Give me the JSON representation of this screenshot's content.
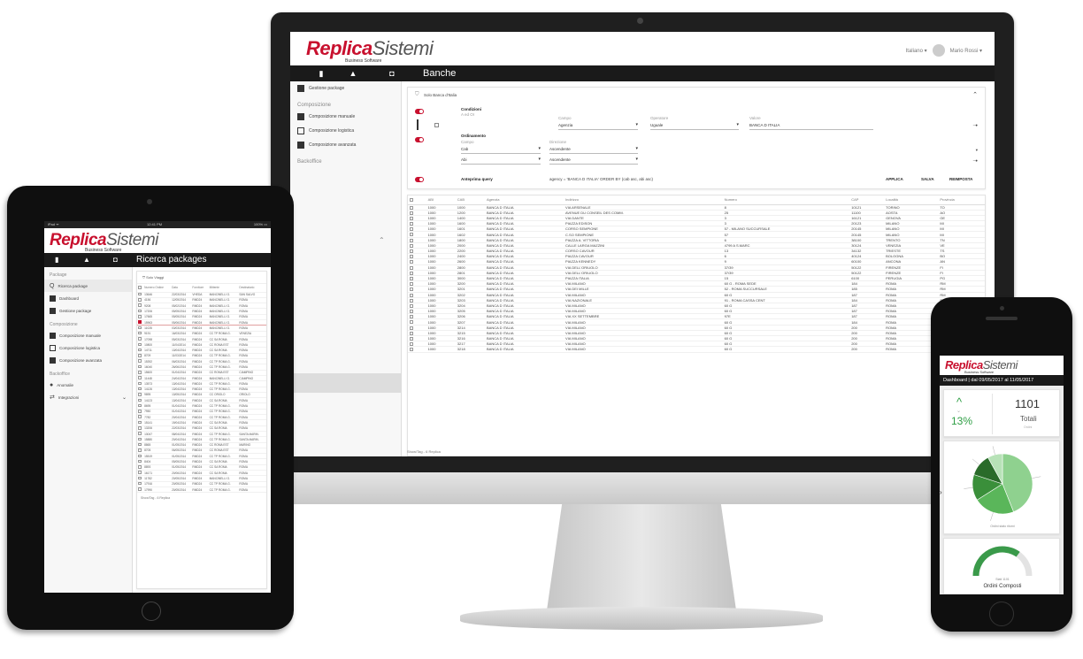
{
  "brand": {
    "name_a": "Replica",
    "name_b": "Sistemi",
    "tagline": "Business Software"
  },
  "desktop": {
    "user": {
      "language": "Italiano ▾",
      "name": "Mario Rossi ▾"
    },
    "nav_title": "Banche",
    "sidebar": {
      "top_item": "Gestione package",
      "section_composizione": "Composizione",
      "items": [
        "Composizione manuale",
        "Composizione logistica",
        "Composizione avanzata"
      ],
      "section_backoffice": "Backoffice"
    },
    "filter": {
      "title": "Solo Banca d'Italia",
      "conditions_label": "Condizioni",
      "conditions_sub": "A ed OI",
      "campo_label": "Campo",
      "campo_value": "Agenzia",
      "operatore_label": "Operatore",
      "operatore_value": "Uguale",
      "valore_label": "Valore",
      "valore_value": "BANCA D ITALIA",
      "ordering_label": "Ordinamento",
      "ord_campo_label": "Campo",
      "ord_dir_label": "Direzione",
      "ord_rows": [
        {
          "campo": "Cab",
          "dir": "Ascendente"
        },
        {
          "campo": "Abi",
          "dir": "Ascendente"
        }
      ],
      "query_label": "Anteprima query",
      "query_value": "agency = 'BANCA D ITALIA' ORDER BY (cab asc, abi asc)",
      "apply": "APPLICA",
      "save": "SALVA",
      "reset": "REIMPOSTA"
    },
    "table": {
      "headers": [
        "ABI",
        "CAB",
        "Agenzia",
        "Indirizzo",
        "Numero",
        "CAP",
        "Località",
        "Provincia"
      ],
      "rows": [
        [
          "1000",
          "1000",
          "BANCA D ITALIA",
          "VIA ARSENALE",
          "8",
          "10121",
          "TORINO",
          "TO"
        ],
        [
          "1000",
          "1200",
          "BANCA D ITALIA",
          "AVENUE DU CONSEIL DES COMM.",
          "25",
          "11100",
          "AOSTA",
          "AO"
        ],
        [
          "1000",
          "1400",
          "BANCA D ITALIA",
          "VIA DANTE",
          "3",
          "16121",
          "GENOVA",
          "GE"
        ],
        [
          "1000",
          "1600",
          "BANCA D ITALIA",
          "PIAZZA EDISON",
          "3",
          "20123",
          "MILANO",
          "MI"
        ],
        [
          "1000",
          "1601",
          "BANCA D ITALIA",
          "CORSO SEMPIONE",
          "57 - MILANO SUCCURSALE",
          "20145",
          "MILANO",
          "MI"
        ],
        [
          "1000",
          "1602",
          "BANCA D ITALIA",
          "C.SO SEMPIONE",
          "57",
          "20145",
          "MILANO",
          "MI"
        ],
        [
          "1000",
          "1800",
          "BANCA D ITALIA",
          "PIAZZA A. VITTORIA",
          "6",
          "38100",
          "TRENTO",
          "TN"
        ],
        [
          "1000",
          "2000",
          "BANCA D ITALIA",
          "CALLE LARGA MAZZINI",
          "4799 A S.MARC",
          "30124",
          "VENEZIA",
          "VE"
        ],
        [
          "1000",
          "2200",
          "BANCA D ITALIA",
          "CORSO CAVOUR",
          "13",
          "34132",
          "TRIESTE",
          "TS"
        ],
        [
          "1000",
          "2400",
          "BANCA D ITALIA",
          "PIAZZA CAVOUR",
          "6",
          "40124",
          "BOLOGNA",
          "BO"
        ],
        [
          "1000",
          "2600",
          "BANCA D ITALIA",
          "PIAZZA KENNEDY",
          "9",
          "60100",
          "ANCONA",
          "AN"
        ],
        [
          "1000",
          "2800",
          "BANCA D ITALIA",
          "VIA DELL'ORIUOLO",
          "37/39",
          "50122",
          "FIRENZE",
          "FI"
        ],
        [
          "1000",
          "2801",
          "BANCA D ITALIA",
          "VIA DELL'ORIUOLO",
          "37/39",
          "50122",
          "FIRENZE",
          "FI"
        ],
        [
          "1000",
          "3000",
          "BANCA D ITALIA",
          "PIAZZA ITALIA",
          "15",
          "6100",
          "PERUGIA",
          "PG"
        ],
        [
          "1000",
          "3200",
          "BANCA D ITALIA",
          "VIA MILANO",
          "60 G - ROMA SEDE",
          "184",
          "ROMA",
          "RM"
        ],
        [
          "1000",
          "3201",
          "BANCA D ITALIA",
          "VIA DEI MILLE",
          "52 - ROMA SUCCURSALE",
          "185",
          "ROMA",
          "RM"
        ],
        [
          "1000",
          "3202",
          "BANCA D ITALIA",
          "VIA MILANO",
          "60 G",
          "187",
          "ROMA",
          "RM"
        ],
        [
          "1000",
          "3203",
          "BANCA D ITALIA",
          "VIA NAZIONALE",
          "91 - ROMA CASSA CENT",
          "184",
          "ROMA",
          "RM"
        ],
        [
          "1000",
          "3204",
          "BANCA D ITALIA",
          "VIA MILANO",
          "60 G",
          "187",
          "ROMA",
          "RM"
        ],
        [
          "1000",
          "3205",
          "BANCA D ITALIA",
          "VIA MILANO",
          "60 G",
          "187",
          "ROMA",
          "RM"
        ],
        [
          "1000",
          "3206",
          "BANCA D ITALIA",
          "VIA XX SETTEMBRE",
          "97E",
          "187",
          "ROMA",
          "RM"
        ],
        [
          "1000",
          "3207",
          "BANCA D ITALIA",
          "VIA MILANO",
          "60 G",
          "184",
          "ROMA",
          "RM"
        ],
        [
          "1000",
          "3214",
          "BANCA D ITALIA",
          "VIA MILANO",
          "60 G",
          "200",
          "ROMA",
          "RM"
        ],
        [
          "1000",
          "3215",
          "BANCA D ITALIA",
          "VIA MILANO",
          "60 G",
          "200",
          "ROMA",
          "RM"
        ],
        [
          "1000",
          "3216",
          "BANCA D ITALIA",
          "VIA MILANO",
          "60 G",
          "200",
          "ROMA",
          "RM"
        ],
        [
          "1000",
          "3217",
          "BANCA D ITALIA",
          "VIA MILANO",
          "60 G",
          "200",
          "ROMA",
          "RM"
        ],
        [
          "1000",
          "3218",
          "BANCA D ITALIA",
          "VIA MILANO",
          "60 G",
          "200",
          "ROMA",
          "RM"
        ]
      ],
      "footer": "Show/Tag - 6 Replica"
    }
  },
  "tablet": {
    "status_left": "iPad ᯤ",
    "status_center": "12:41 PM",
    "status_right": "100% ▭",
    "nav_title": "Ricerca packages",
    "sidebar": {
      "section_package": "Package",
      "items_package": [
        "Ricerca package",
        "Dashboard",
        "Gestione package"
      ],
      "section_composizione": "Composizione",
      "items_comp": [
        "Composizione manuale",
        "Composizione logistica",
        "Composizione avanzata"
      ],
      "section_backoffice": "Backoffice",
      "items_back": [
        "Anomalie",
        "Integrazioni"
      ]
    },
    "filter_label": "Solo Viaggi",
    "table": {
      "headers": [
        "Numero Ordine",
        "Data",
        "Fornitore",
        "Mittente",
        "Destinatario"
      ],
      "rows": [
        [
          "13646",
          "22/03/2014",
          "VHEDA",
          "MANCINELLI G.",
          "SAN SALVO"
        ],
        [
          "4156",
          "12/05/2014",
          "RMD24",
          "MANCINELLI G.",
          "ROMA"
        ],
        [
          "9208",
          "05/02/2014",
          "RMD24",
          "MANCINELLI G.",
          "ROMA"
        ],
        [
          "17206",
          "05/05/2014",
          "RMD24",
          "MANCINELLI G.",
          "ROMA"
        ],
        [
          "17665",
          "05/05/2014",
          "RMD24",
          "MANCINELLI G.",
          "ROMA"
        ],
        [
          "15963",
          "05/06/2014",
          "RMD24",
          "MANCINELLI G.",
          "ROMA"
        ],
        [
          "11028",
          "03/03/2014",
          "RMD24",
          "MANCINELLI G.",
          "ROMA"
        ],
        [
          "9191",
          "16/03/2014",
          "RMD24",
          "CC TP ROMA G.",
          "VENEZIA"
        ],
        [
          "17098",
          "05/03/2014",
          "RMD24",
          "CC SA ROMA",
          "ROMA"
        ],
        [
          "10800",
          "11/04/2014",
          "RMD24",
          "CC ROMA EST",
          "ROMA"
        ],
        [
          "14711",
          "13/04/2014",
          "RMD24",
          "CC SA ROMA",
          "ROMA"
        ],
        [
          "8709",
          "11/03/2014",
          "RMD24",
          "CC TP ROMA G.",
          "ROMA"
        ],
        [
          "15392",
          "06/03/2014",
          "RMD24",
          "CC TP ROMA G.",
          "ROMA"
        ],
        [
          "16040",
          "26/06/2014",
          "RMD24",
          "CC TP ROMA G.",
          "ROMA"
        ],
        [
          "15600",
          "01/04/2014",
          "RMD24",
          "CC ROMA EST",
          "CIAMPINO"
        ],
        [
          "11448",
          "24/04/2014",
          "RMD24",
          "MANCINELLI G.",
          "CIAMPINO"
        ],
        [
          "13573",
          "13/04/2014",
          "RMD24",
          "CC TP ROMA G.",
          "ROMA"
        ],
        [
          "14126",
          "13/04/2014",
          "RMD24",
          "CC TP ROMA G.",
          "ROMA"
        ],
        [
          "9895",
          "13/05/2014",
          "RMD24",
          "CC ORIOLO",
          "ORIOLO"
        ],
        [
          "14123",
          "13/04/2014",
          "RMD24",
          "CC SA ROMA",
          "ROMA"
        ],
        [
          "8695",
          "01/04/2014",
          "RMD24",
          "CC TP ROMA G.",
          "ROMA"
        ],
        [
          "7950",
          "01/04/2014",
          "RMD24",
          "CC TP ROMA G.",
          "ROMA"
        ],
        [
          "7782",
          "20/04/2014",
          "RMD24",
          "CC TP ROMA G.",
          "ROMA"
        ],
        [
          "15141",
          "19/04/2014",
          "RMD24",
          "CC SA ROMA",
          "ROMA"
        ],
        [
          "13206",
          "22/03/2014",
          "RMD24",
          "CC SA ROMA",
          "ROMA"
        ],
        [
          "13047",
          "08/04/2014",
          "RMD24",
          "CC TP ROMA G.",
          "SANTA MARIN."
        ],
        [
          "15880",
          "20/04/2014",
          "RMD24",
          "CC TP ROMA G.",
          "SANTA MARIN."
        ],
        [
          "8865",
          "01/05/2014",
          "RMD24",
          "CC ROMA EST",
          "MARINO"
        ],
        [
          "8705",
          "06/05/2014",
          "RMD24",
          "CC ROMA EST",
          "ROMA"
        ],
        [
          "15519",
          "01/05/2014",
          "RMD24",
          "CC TP ROMA G.",
          "ROMA"
        ],
        [
          "8404",
          "05/05/2014",
          "RMD24",
          "CC SA ROMA",
          "ROMA"
        ],
        [
          "8893",
          "01/05/2014",
          "RMD24",
          "CC SA ROMA",
          "ROMA"
        ],
        [
          "16171",
          "20/06/2014",
          "RMD24",
          "CC SA ROMA",
          "ROMA"
        ],
        [
          "11782",
          "20/05/2014",
          "RMD24",
          "MANCINELLI G.",
          "ROMA"
        ],
        [
          "17916",
          "20/05/2014",
          "RMD24",
          "CC TP ROMA G.",
          "ROMA"
        ],
        [
          "17990",
          "20/05/2014",
          "RMD24",
          "CC TP ROMA G.",
          "ROMA"
        ]
      ],
      "footer": "Show/Tag - 6 Replica"
    }
  },
  "phone": {
    "dashboard_title": "Dashboard  |  dal 09/05/2017 al 11/05/2017",
    "kpi_percent": "13%",
    "kpi_value": "1101",
    "kpi_label": "Totali",
    "kpi_sub": "Ordini",
    "pie_caption": "Ordini stato ritorni",
    "gauge_value": "Stati 1101",
    "gauge_label": "Ordini Composti",
    "pie_slices": [
      44,
      22,
      14,
      12,
      8
    ],
    "pie_colors": [
      "#8fd18f",
      "#5ab65a",
      "#3a8f3a",
      "#2a6b2a",
      "#b7e2b7"
    ],
    "gauge_fraction": 0.7,
    "colors": {
      "accent": "#c8102e",
      "green": "#2e9e44"
    }
  }
}
